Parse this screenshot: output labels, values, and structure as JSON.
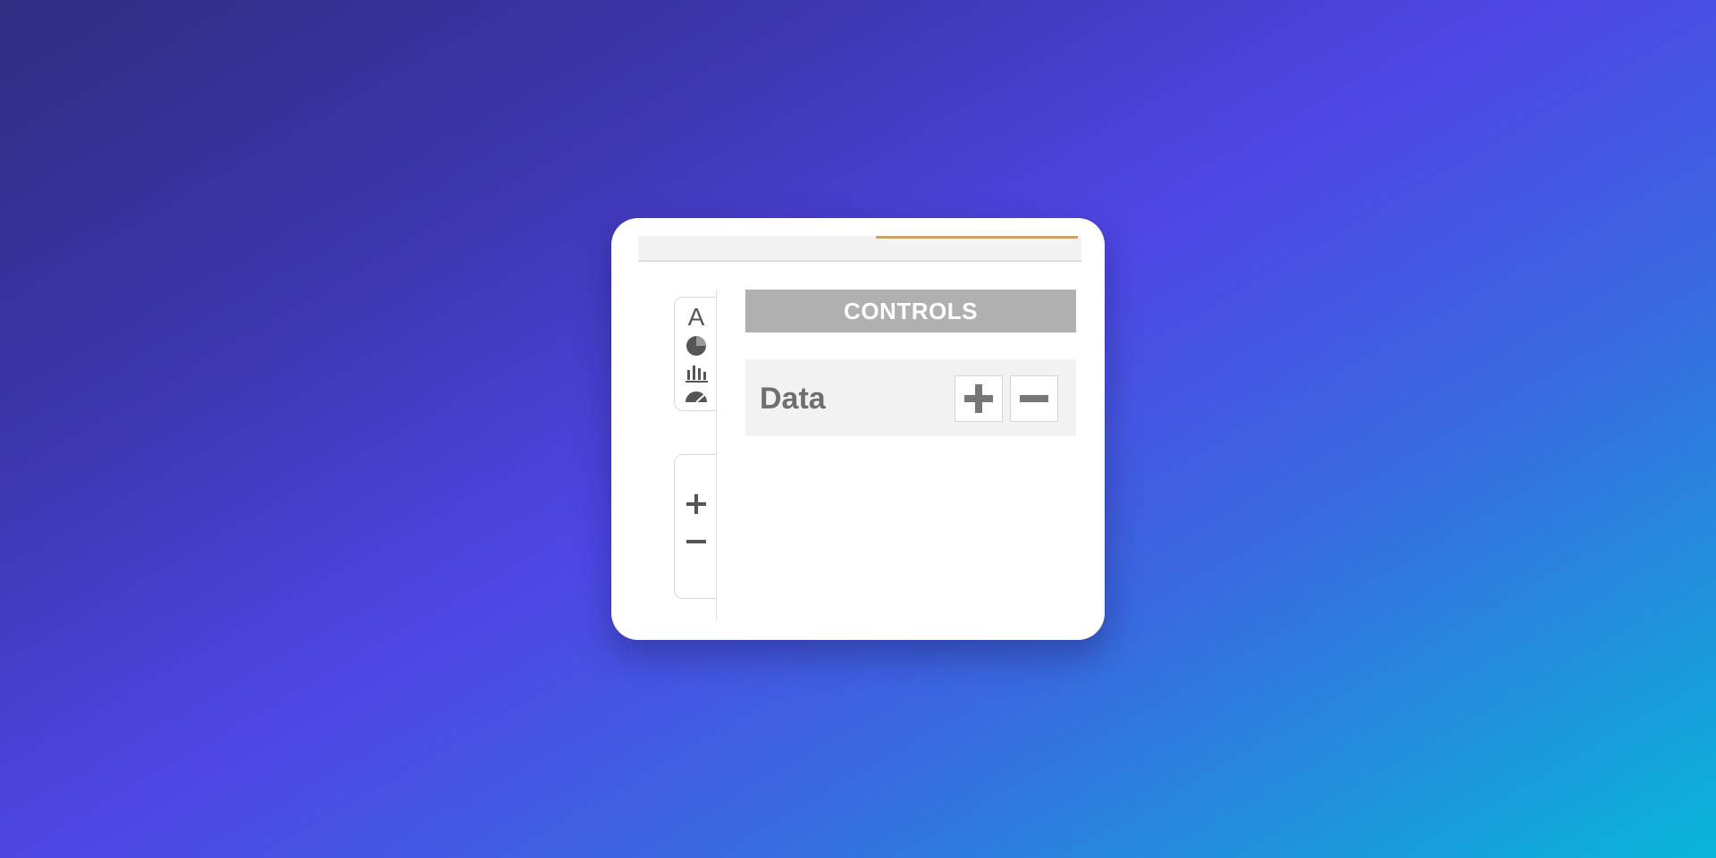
{
  "toolbar": {
    "tools": [
      {
        "name": "text-tool",
        "label": "A",
        "icon": "letter-a-icon"
      },
      {
        "name": "pie-chart-tool",
        "icon": "pie-chart-icon"
      },
      {
        "name": "bar-chart-tool",
        "icon": "bar-chart-icon"
      },
      {
        "name": "gauge-tool",
        "icon": "gauge-icon"
      }
    ],
    "zoom": [
      {
        "name": "zoom-in",
        "icon": "plus-icon"
      },
      {
        "name": "zoom-out",
        "icon": "minus-icon"
      }
    ]
  },
  "controls": {
    "title": "CONTROLS",
    "data_label": "Data",
    "add_icon": "plus-icon",
    "remove_icon": "minus-icon"
  },
  "colors": {
    "accent": "#c9a46a",
    "header_bg": "#b0b0b0",
    "icon": "#555555"
  }
}
